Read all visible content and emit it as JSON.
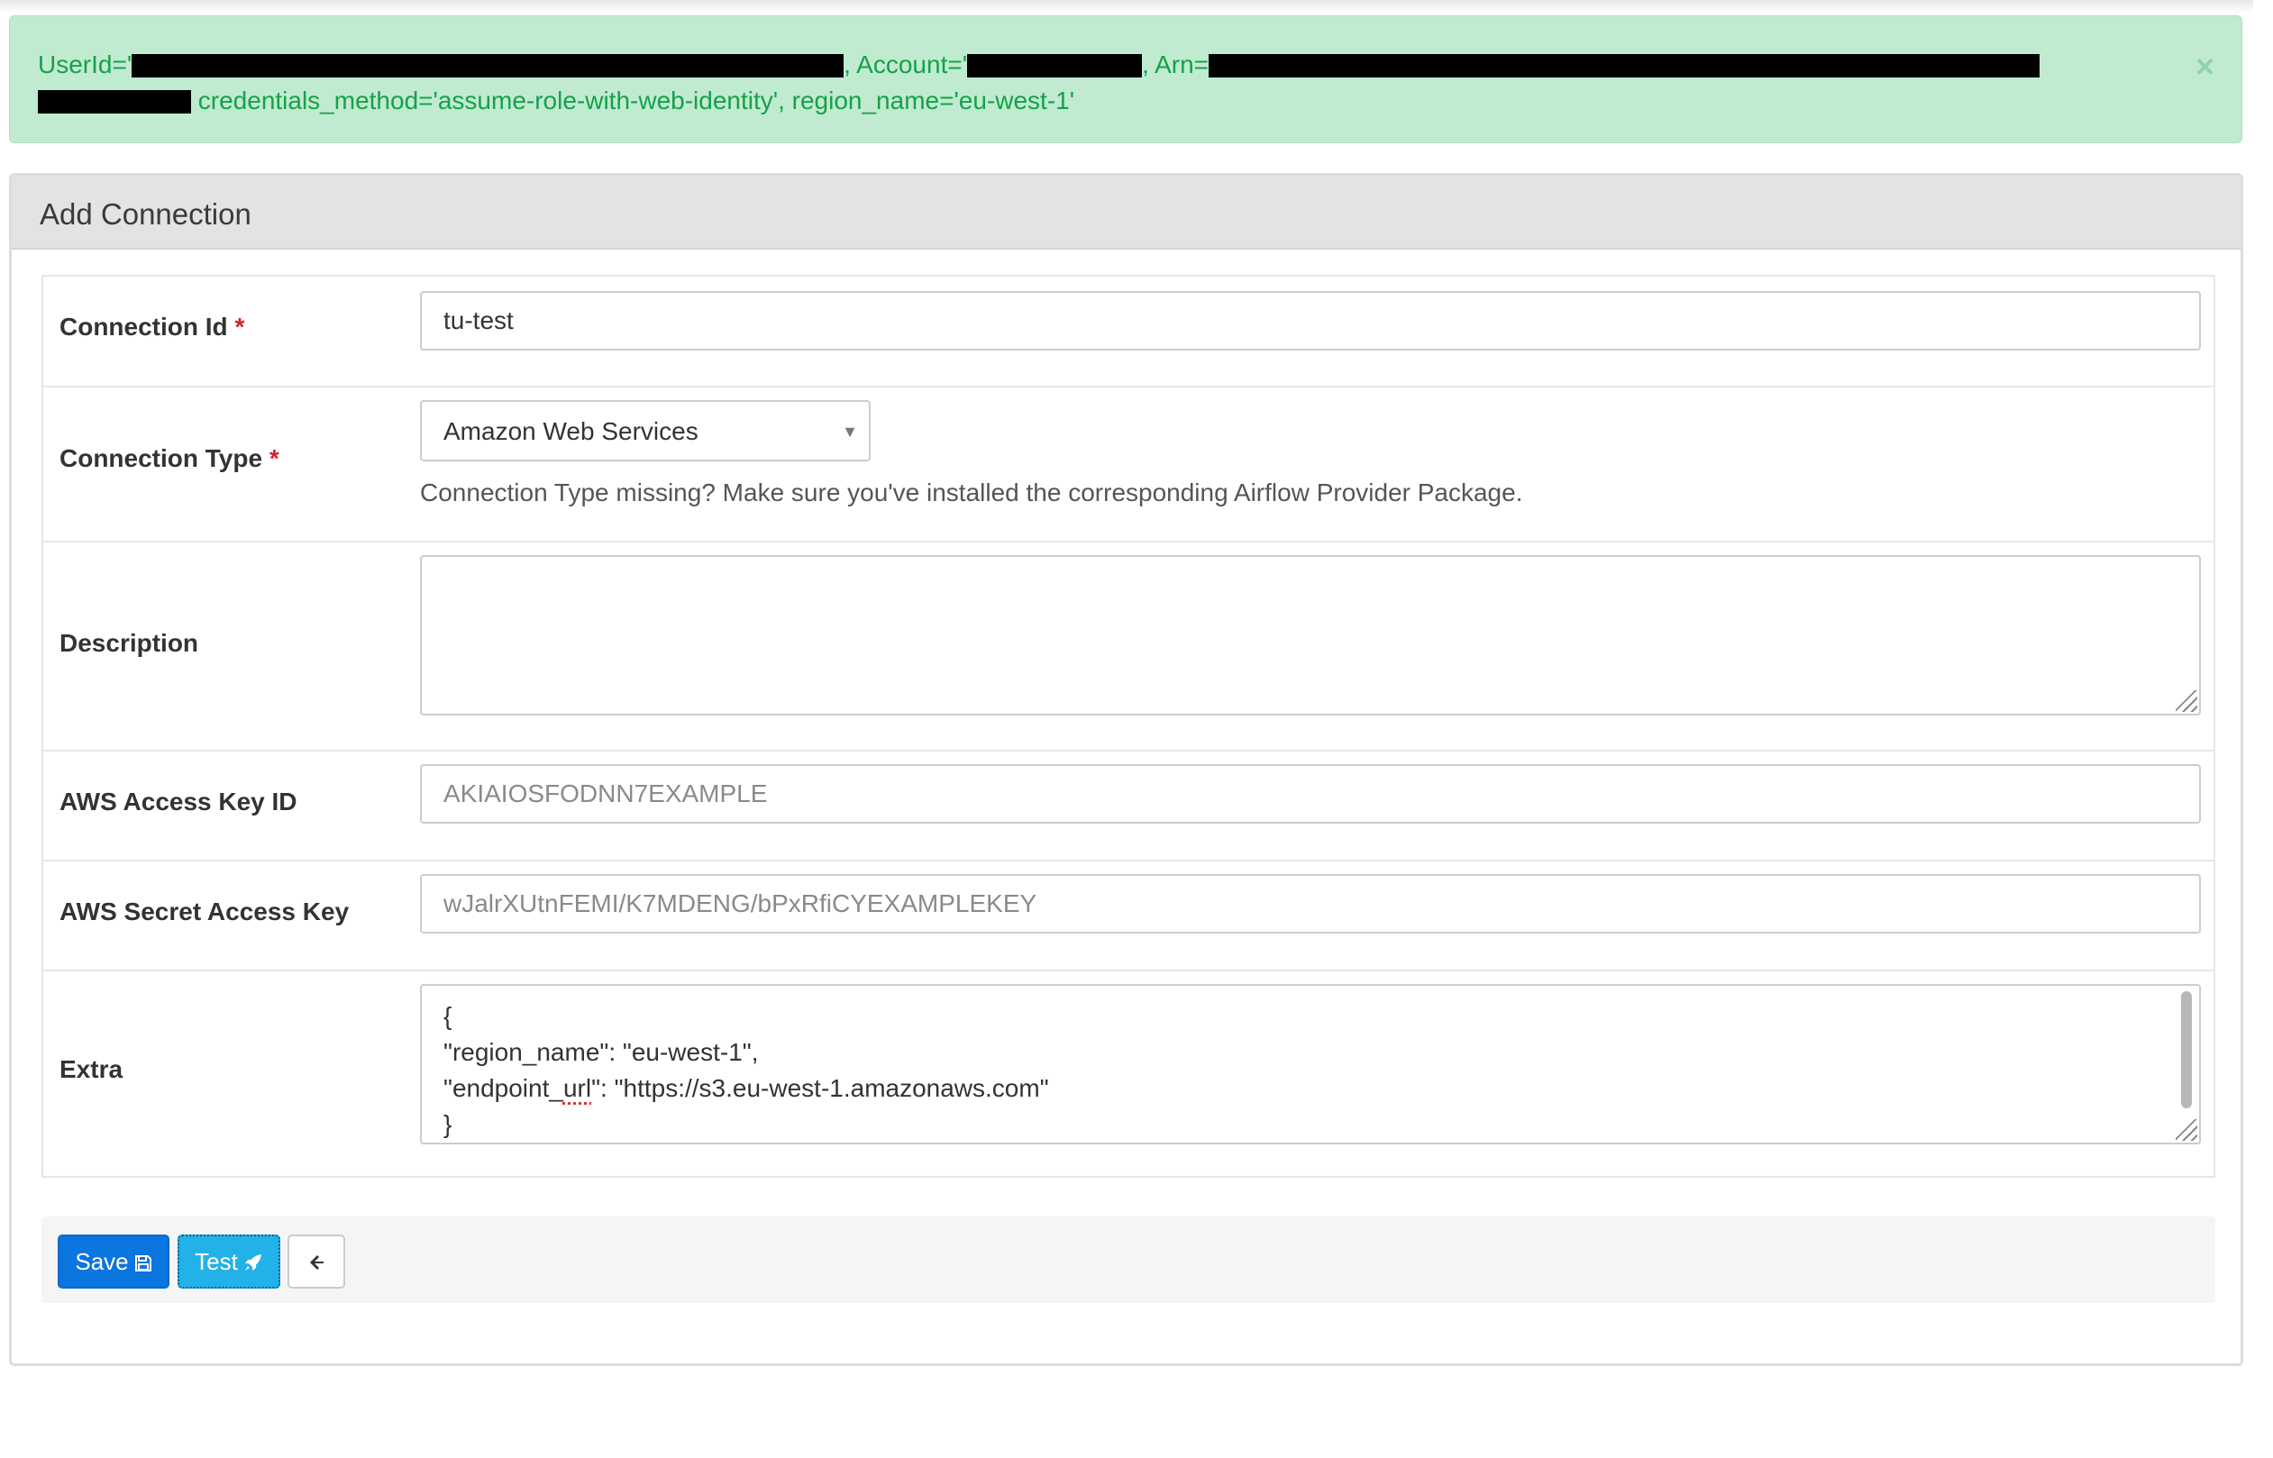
{
  "alert": {
    "userid_label": "UserId='",
    "account_label": ", Account='",
    "arn_label": ", Arn=",
    "line2_text": " credentials_method='assume-role-with-web-identity', region_name='eu-west-1'",
    "close_glyph": "×"
  },
  "panel": {
    "title": "Add Connection"
  },
  "form": {
    "conn_id": {
      "label": "Connection Id",
      "required_mark": "*",
      "value": "tu-test"
    },
    "conn_type": {
      "label": "Connection Type",
      "required_mark": "*",
      "selected": "Amazon Web Services",
      "help": "Connection Type missing? Make sure you've installed the corresponding Airflow Provider Package."
    },
    "description": {
      "label": "Description",
      "value": ""
    },
    "aws_access_key_id": {
      "label": "AWS Access Key ID",
      "placeholder": "AKIAIOSFODNN7EXAMPLE"
    },
    "aws_secret_access_key": {
      "label": "AWS Secret Access Key",
      "placeholder": "wJalrXUtnFEMI/K7MDENG/bPxRfiCYEXAMPLEKEY"
    },
    "extra": {
      "label": "Extra",
      "line1": "{",
      "line2": "\"region_name\": \"eu-west-1\",",
      "line3_pre": "\"endpoint_",
      "line3_spell": "url",
      "line3_post": "\": \"https://s3.eu-west-1.amazonaws.com\"",
      "line4": "}"
    }
  },
  "actions": {
    "save_label": "Save",
    "test_label": "Test"
  },
  "icons": {
    "save": "floppy-disk-icon",
    "test": "rocket-icon",
    "back": "arrow-left-icon",
    "close": "close-icon"
  },
  "colors": {
    "alert_bg": "#c0ebd0",
    "alert_text": "#15a14a",
    "save_btn": "#0b75e0",
    "test_btn": "#22b2e8",
    "required": "#d8232a"
  }
}
